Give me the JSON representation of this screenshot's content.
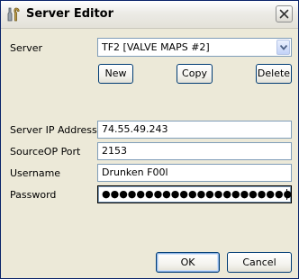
{
  "window": {
    "title": "Server Editor",
    "icon": "tools-icon",
    "close_icon": "close-icon"
  },
  "server": {
    "label": "Server",
    "selected": "TF2 [VALVE MAPS #2]",
    "new_label": "New",
    "copy_label": "Copy",
    "delete_label": "Delete"
  },
  "fields": {
    "ip_label": "Server IP Address",
    "ip_value": "74.55.49.243",
    "port_label": "SourceOP Port",
    "port_value": "2153",
    "username_label": "Username",
    "username_value": "Drunken F00l",
    "password_label": "Password",
    "password_value": "●●●●●●●●●●●●●●●●●●●●●●●●●●●●●"
  },
  "footer": {
    "ok_label": "OK",
    "cancel_label": "Cancel"
  },
  "colors": {
    "dialog_background": "#ece9d8",
    "input_border": "#7f9db9",
    "button_border": "#003c74"
  }
}
